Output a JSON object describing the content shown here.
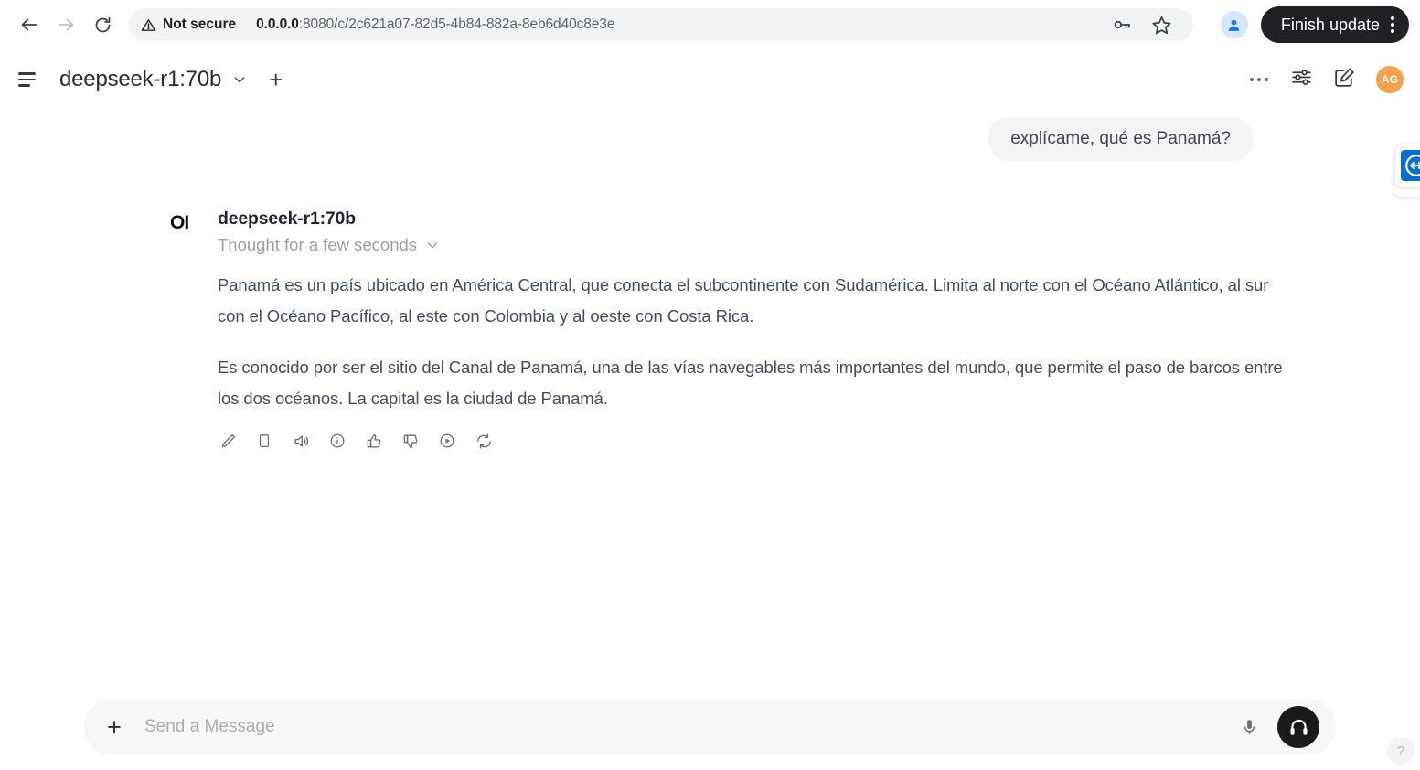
{
  "browser": {
    "back_label": "Back",
    "forward_label": "Forward",
    "reload_label": "Reload",
    "security_label": "Not secure",
    "url_host": "0.0.0.0",
    "url_path": ":8080/c/2c621a07-82d5-4b84-882a-8eb6d40c8e3e",
    "passwords_label": "Passwords",
    "bookmark_label": "Bookmark this tab",
    "profile_label": "Profile",
    "finish_update_label": "Finish update",
    "menu_label": "Customize and control Chrome"
  },
  "app_header": {
    "sidebar_toggle_label": "Toggle sidebar",
    "model": "deepseek-r1:70b",
    "model_chevron": "chevron-down",
    "new_chat_label": "+",
    "more_label": "More",
    "controls_label": "Chat controls",
    "new_note_label": "New chat",
    "avatar_initials": "AG"
  },
  "chat": {
    "user_message": "explícame, qué es Panamá?",
    "assistant": {
      "logo_text": "OI",
      "name": "deepseek-r1:70b",
      "thought_label": "Thought for a few seconds",
      "paragraphs": [
        "Panamá es un país ubicado en América Central, que conecta el subcontinente con Sudamérica. Limita al norte con el Océano Atlántico, al sur con el Océano Pacífico, al este con Colombia y al oeste con Costa Rica.",
        "Es conocido por ser el sitio del Canal de Panamá, una de las vías navegables más importantes del mundo, que permite el paso de barcos entre los dos océanos. La capital es la ciudad de Panamá."
      ],
      "actions": [
        {
          "name": "edit-icon",
          "label": "Edit"
        },
        {
          "name": "copy-icon",
          "label": "Copy"
        },
        {
          "name": "speaker-icon",
          "label": "Read aloud"
        },
        {
          "name": "info-icon",
          "label": "Info"
        },
        {
          "name": "thumbs-up-icon",
          "label": "Good response"
        },
        {
          "name": "thumbs-down-icon",
          "label": "Bad response"
        },
        {
          "name": "play-circle-icon",
          "label": "Continue response"
        },
        {
          "name": "refresh-icon",
          "label": "Regenerate"
        }
      ]
    }
  },
  "composer": {
    "attach_label": "+",
    "placeholder": "Send a Message",
    "value": "",
    "mic_label": "Voice input",
    "call_label": "Call"
  },
  "floating": {
    "teamviewer_label": "TeamViewer",
    "help_label": "?"
  },
  "colors": {
    "accent_orange": "#f5a04a",
    "teamviewer_blue": "#0a6ed1",
    "text_body": "#434d5e",
    "bubble_bg": "#f4f4f5",
    "dark_button": "#202124"
  }
}
